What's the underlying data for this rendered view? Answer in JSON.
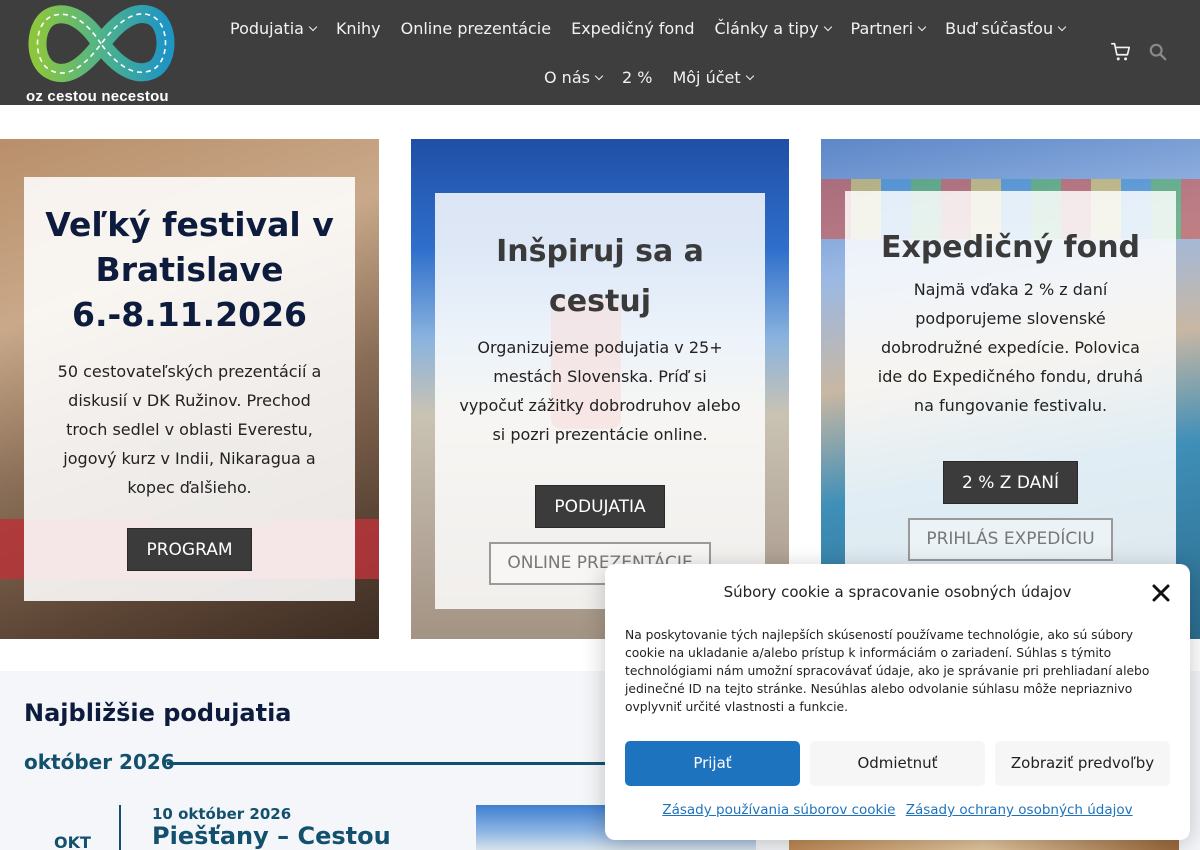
{
  "header": {
    "logo_text": "oz cestou necestou",
    "nav_row1": [
      {
        "label": "Podujatia",
        "dropdown": true
      },
      {
        "label": "Knihy",
        "dropdown": false
      },
      {
        "label": "Online prezentácie",
        "dropdown": false
      },
      {
        "label": "Expedičný fond",
        "dropdown": false
      },
      {
        "label": "Články a tipy",
        "dropdown": true
      },
      {
        "label": "Partneri",
        "dropdown": true
      },
      {
        "label": "Buď súčasťou",
        "dropdown": true
      }
    ],
    "nav_row2": [
      {
        "label": "O nás",
        "dropdown": true
      },
      {
        "label": "2 %",
        "dropdown": false
      },
      {
        "label": "Môj účet",
        "dropdown": true
      }
    ],
    "icons": [
      "cart-icon",
      "search-icon"
    ]
  },
  "cards": [
    {
      "title": "Veľký festival v Bratislave 6.-8.11.2026",
      "text": "50 cestovateľských prezentácií a diskusií v DK Ružinov. Prechod troch sedlel v oblasti Everestu, jogový kurz v Indii, Nikaragua a kopec ďalšieho.",
      "button": "PROGRAM"
    },
    {
      "title": "Inšpiruj sa a cestuj",
      "text": "Organizujeme podujatia v 25+ mestách Slovenska. Príď si vypočuť zážitky dobrodruhov alebo si pozri prezentácie online.",
      "button": "PODUJATIA",
      "button2": "ONLINE PREZENTÁCIE"
    },
    {
      "title": "Expedičný fond",
      "text": "Najmä vďaka 2 % z daní podporujeme slovenské dobrodružné expedície. Polovica ide do Expedičného fondu, druhá na fungovanie festivalu.",
      "button": "2 % Z DANÍ",
      "button2": "PRIHLÁS EXPEDÍCIU"
    }
  ],
  "events": {
    "title": "Najbližšie podujatia",
    "month": "október 2026",
    "item": {
      "day_label": "OKT",
      "date": "10 október 2026",
      "title": "Piešťany – Cestou"
    }
  },
  "cookie": {
    "title": "Súbory cookie a spracovanie osobných údajov",
    "text": "Na poskytovanie tých najlepších skúseností používame technológie, ako sú súbory cookie na ukladanie a/alebo prístup k informáciám o zariadení. Súhlas s týmito technológiami nám umožní spracovávať údaje, ako je správanie pri prehliadaní alebo jedinečné ID na tejto stránke. Nesúhlas alebo odvolanie súhlasu môže nepriaznivo ovplyvniť určité vlastnosti a funkcie.",
    "accept": "Prijať",
    "deny": "Odmietnuť",
    "prefs": "Zobraziť predvoľby",
    "link1": "Zásady používania súborov cookie",
    "link2": "Zásady ochrany osobných údajov"
  },
  "colors": {
    "header_bg": "#3e3e3e",
    "accent_blue": "#1e73be",
    "heading_navy": "#0d1b3d",
    "event_teal": "#13506e",
    "logo_green": "#7cc242",
    "logo_blue": "#2e9bb5"
  }
}
